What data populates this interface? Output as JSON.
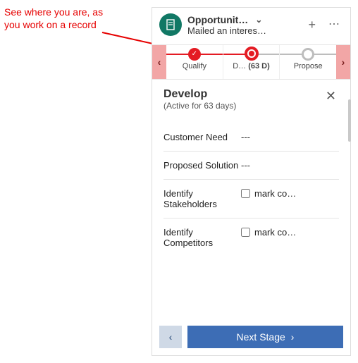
{
  "annotation": {
    "line1": "See where you are, as",
    "line2": "you work on a record"
  },
  "header": {
    "title": "Opportunit…",
    "subtitle": "Mailed an interes…"
  },
  "stages": [
    {
      "label": "Qualify",
      "state": "done"
    },
    {
      "label": "D…",
      "extra": "(63 D)",
      "state": "active"
    },
    {
      "label": "Propose",
      "state": "future"
    }
  ],
  "detail": {
    "title": "Develop",
    "subtitle": "(Active for 63 days)",
    "fields": [
      {
        "label": "Customer Need",
        "type": "text",
        "value": "---"
      },
      {
        "label": "Proposed Solution",
        "type": "text",
        "value": "---"
      },
      {
        "label": "Identify Stakeholders",
        "type": "check",
        "checkLabel": "mark co…"
      },
      {
        "label": "Identify Competitors",
        "type": "check",
        "checkLabel": "mark co…"
      }
    ]
  },
  "footer": {
    "next": "Next Stage"
  }
}
